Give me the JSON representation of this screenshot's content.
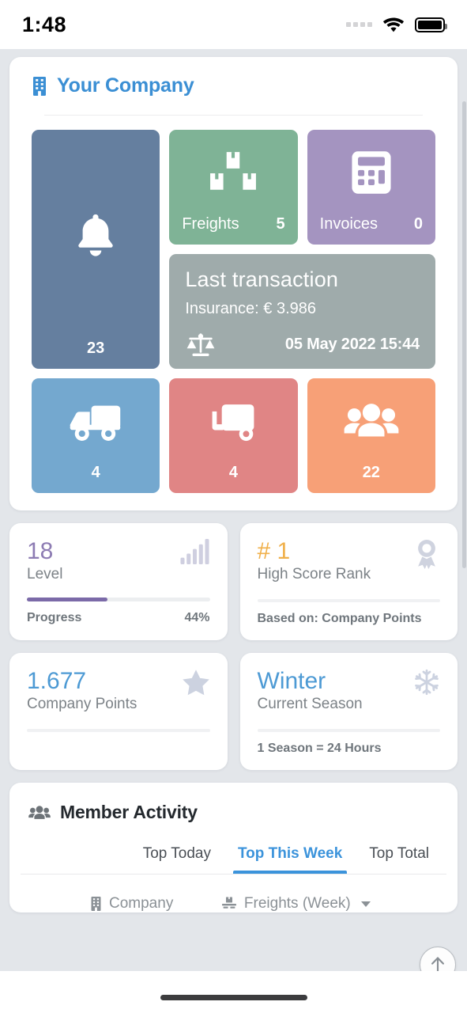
{
  "status_bar": {
    "time": "1:48",
    "signal_icon": "signal-dots-icon",
    "wifi_icon": "wifi-icon",
    "battery_icon": "battery-full-icon"
  },
  "company_card": {
    "icon": "building-icon",
    "title": "Your Company",
    "tiles": {
      "notifications": {
        "icon": "bell-icon",
        "label": "",
        "value": "23",
        "color": "#657f9f"
      },
      "freights": {
        "icon": "boxes-icon",
        "label": "Freights",
        "value": "5",
        "color": "#7fb396"
      },
      "invoices": {
        "icon": "calculator-icon",
        "label": "Invoices",
        "value": "0",
        "color": "#a494c0"
      },
      "last_transaction": {
        "title": "Last transaction",
        "subtitle": "Insurance: € 3.986",
        "icon": "scales-icon",
        "date": "05 May 2022 15:44",
        "color": "#9fabab"
      },
      "trucks": {
        "icon": "truck-icon",
        "label": "",
        "value": "4",
        "color": "#74a8cf"
      },
      "trailers": {
        "icon": "trailer-icon",
        "label": "",
        "value": "4",
        "color": "#e08585"
      },
      "members": {
        "icon": "users-icon",
        "label": "",
        "value": "22",
        "color": "#f7a077"
      }
    }
  },
  "stats": {
    "level": {
      "value": "18",
      "label": "Level",
      "icon": "signal-bars-icon",
      "progress_label": "Progress",
      "progress_value": "44%",
      "progress_percent": 44,
      "accent": "#7b6aa8"
    },
    "rank": {
      "value": "# 1",
      "label": "High Score Rank",
      "icon": "award-ribbon-icon",
      "note": "Based on: Company Points",
      "accent": "#f0b04a"
    },
    "points": {
      "value": "1.677",
      "label": "Company Points",
      "icon": "star-icon",
      "note": "",
      "accent": "#4d9ad4"
    },
    "season": {
      "value": "Winter",
      "label": "Current Season",
      "icon": "snowflake-icon",
      "note": "1 Season = 24 Hours",
      "accent": "#4d9ad4"
    }
  },
  "member_activity": {
    "icon": "users-icon",
    "title": "Member Activity",
    "tabs": [
      {
        "label": "Top Today",
        "active": false
      },
      {
        "label": "Top This Week",
        "active": true
      },
      {
        "label": "Top Total",
        "active": false
      }
    ],
    "columns": [
      {
        "label": "Company",
        "icon": "building-icon",
        "sortable": false
      },
      {
        "label": "Freights (Week)",
        "icon": "freight-icon",
        "sortable": true
      }
    ]
  },
  "scroll_top_button": {
    "icon": "arrow-up-icon"
  }
}
